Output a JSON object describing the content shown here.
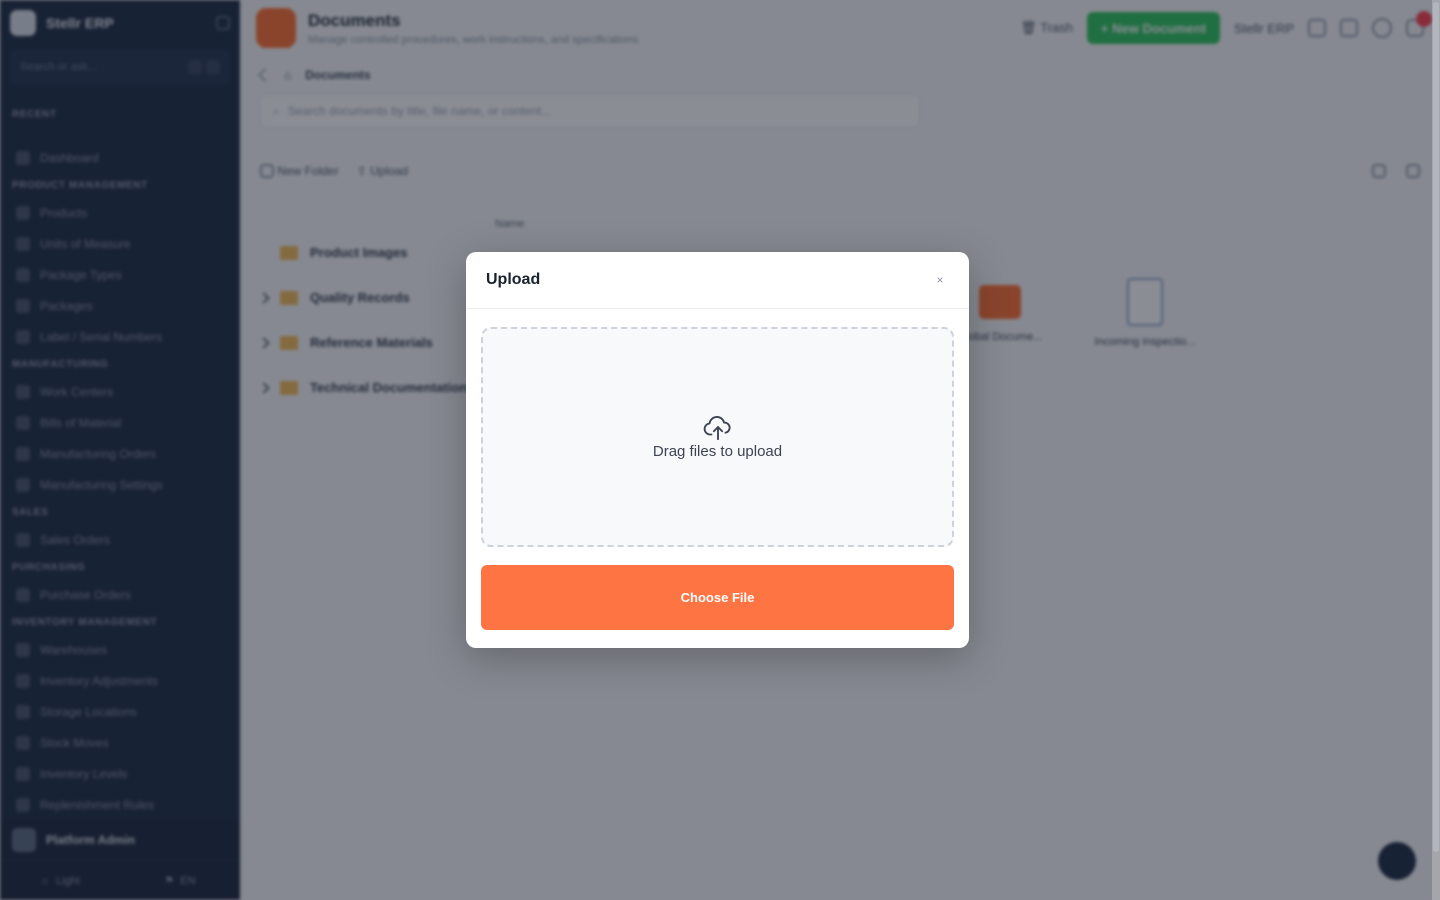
{
  "app": {
    "brand": "Stellr ERP",
    "search_placeholder": "Search or ask...",
    "sidebar": {
      "recent_label": "RECENT",
      "dashboard": "Dashboard",
      "sections": [
        {
          "title": "PRODUCT MANAGEMENT",
          "items": [
            "Products",
            "Units of Measure",
            "Package Types",
            "Packages",
            "Label / Serial Numbers"
          ]
        },
        {
          "title": "MANUFACTURING",
          "items": [
            "Work Centers",
            "Bills of Material",
            "Manufacturing Orders",
            "Manufacturing Settings"
          ]
        },
        {
          "title": "SALES",
          "items": [
            "Sales Orders"
          ]
        },
        {
          "title": "PURCHASING",
          "items": [
            "Purchase Orders"
          ]
        },
        {
          "title": "INVENTORY MANAGEMENT",
          "items": [
            "Warehouses",
            "Inventory Adjustments",
            "Storage Locations",
            "Stock Moves",
            "Inventory Levels",
            "Replenishment Rules"
          ]
        }
      ],
      "user": "Platform Admin",
      "theme_label": "Light",
      "lang_label": "EN"
    },
    "header": {
      "title": "Documents",
      "subtitle": "Manage controlled procedures, work instructions, and specifications",
      "trash_label": "Trash",
      "new_doc_label": "+ New Document",
      "org_label": "Stellr ERP"
    },
    "breadcrumb": "Documents",
    "doc_search_placeholder": "Search documents by title, file name, or content...",
    "toolbar": {
      "new_folder": "New Folder",
      "upload": "Upload"
    },
    "name_column": "Name",
    "tree": [
      "Product Images",
      "Quality Records",
      "Reference Materials",
      "Technical Documentation"
    ],
    "grid": [
      {
        "label": "Global Docume...",
        "kind": "folder"
      },
      {
        "label": "Incoming Inspectio...",
        "kind": "file"
      }
    ]
  },
  "modal": {
    "title": "Upload",
    "close_symbol": "×",
    "drop_text": "Drag files to upload",
    "choose_label": "Choose File"
  },
  "colors": {
    "accent": "#ff7443",
    "sidebar_bg": "#1b2840",
    "primary_green": "#2bc25a"
  }
}
